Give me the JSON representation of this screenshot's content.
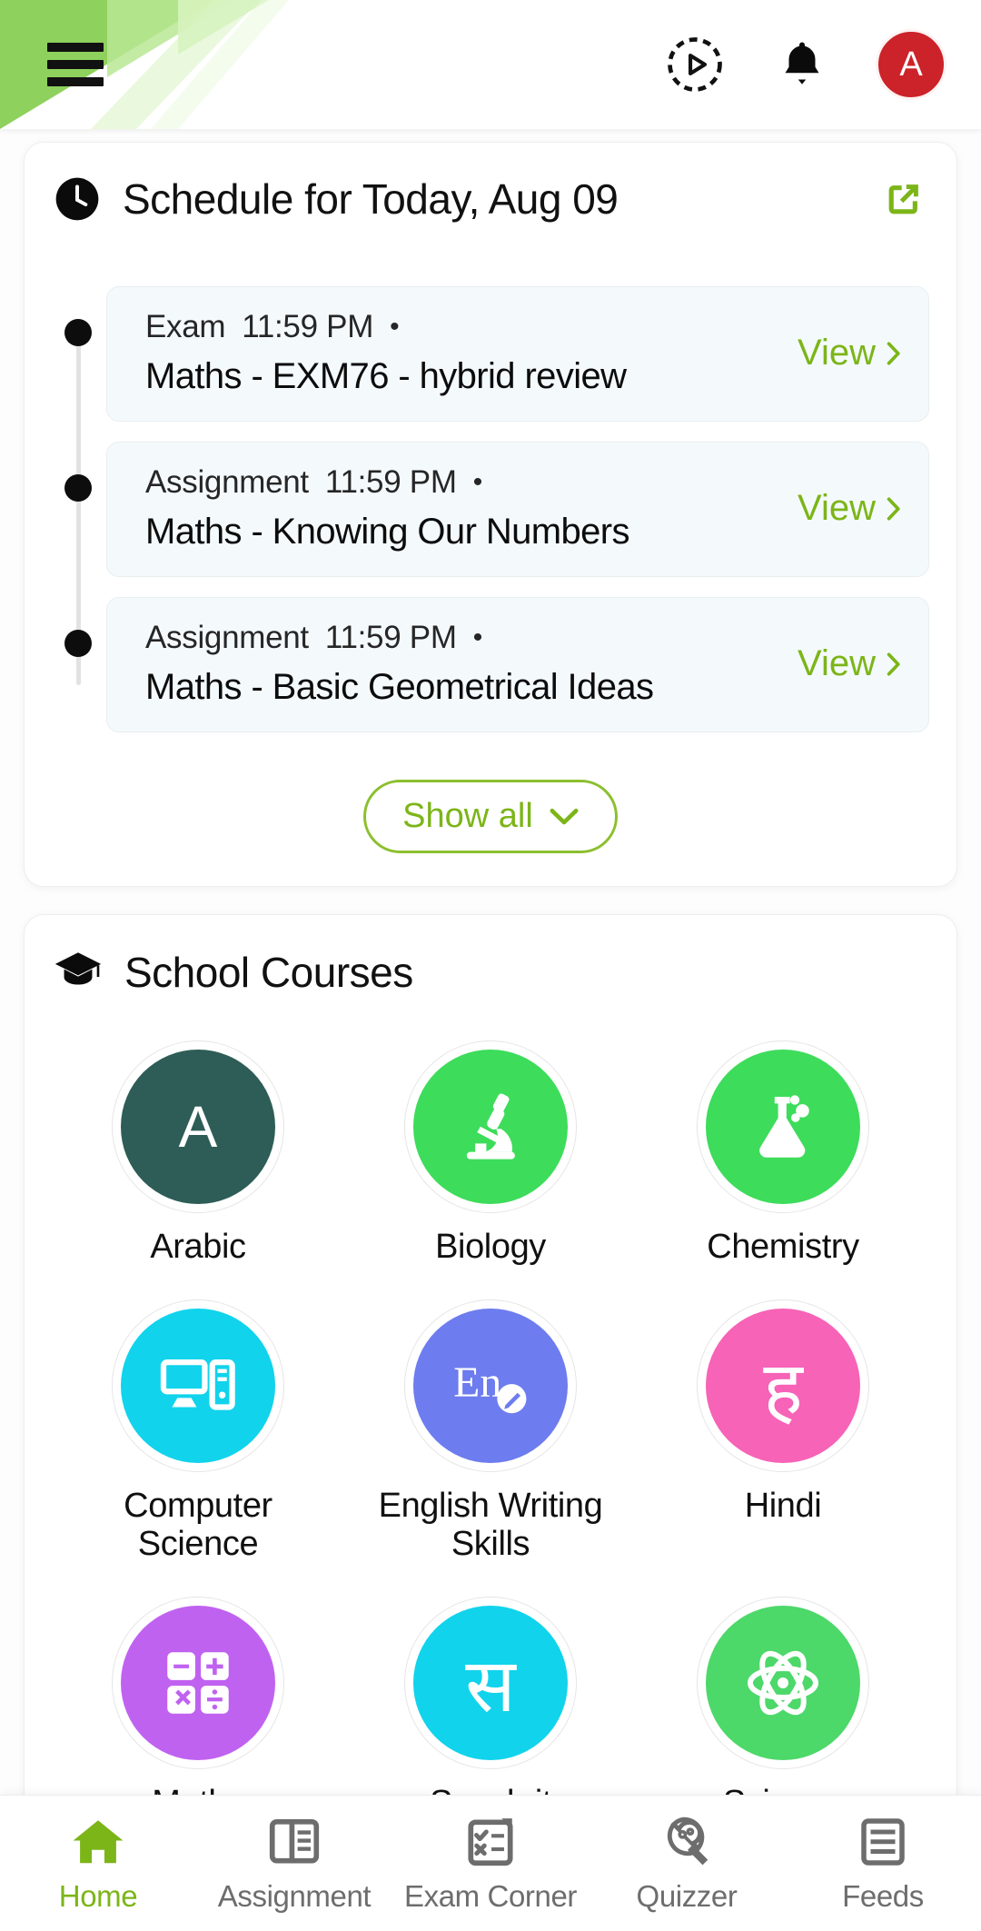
{
  "header": {
    "menu_icon": "hamburger-menu-icon",
    "play_icon": "play-circle-icon",
    "bell_icon": "notification-bell-icon",
    "avatar_initial": "A",
    "avatar_color": "#cc2229",
    "accent_color": "#7cb518"
  },
  "schedule": {
    "icon": "clock-icon",
    "title": "Schedule for Today, Aug 09",
    "expand_icon": "external-link-icon",
    "items": [
      {
        "type": "Exam",
        "time": "11:59 PM",
        "bullet": "•",
        "title": "Maths - EXM76  -  hybrid review",
        "action": "View"
      },
      {
        "type": "Assignment",
        "time": "11:59 PM",
        "bullet": "•",
        "title": "Maths - Knowing Our Numbers",
        "action": "View"
      },
      {
        "type": "Assignment",
        "time": "11:59 PM",
        "bullet": "•",
        "title": "Maths - Basic Geometrical Ideas",
        "action": "View"
      }
    ],
    "show_all_label": "Show all"
  },
  "courses": {
    "icon": "graduation-cap-icon",
    "title": "School Courses",
    "items": [
      {
        "label": "Arabic",
        "glyph": "A",
        "glyph_type": "letter",
        "color": "#2d5d56",
        "icon": "letter-a-icon"
      },
      {
        "label": "Biology",
        "glyph": "",
        "glyph_type": "svg",
        "color": "#3ddc5b",
        "icon": "microscope-icon"
      },
      {
        "label": "Chemistry",
        "glyph": "",
        "glyph_type": "svg",
        "color": "#3ddc5b",
        "icon": "flask-icon"
      },
      {
        "label": "Computer Science",
        "glyph": "",
        "glyph_type": "svg",
        "color": "#11d3ec",
        "icon": "desktop-computer-icon"
      },
      {
        "label": "English Writing Skills",
        "glyph": "En",
        "glyph_type": "svg",
        "color": "#6d7cee",
        "icon": "en-pencil-icon"
      },
      {
        "label": "Hindi",
        "glyph": "ह",
        "glyph_type": "letter-light",
        "color": "#f663b7",
        "icon": "devanagari-ha-icon"
      },
      {
        "label": "Maths",
        "glyph": "",
        "glyph_type": "svg",
        "color": "#c062f0",
        "icon": "calculator-icon"
      },
      {
        "label": "Sanskrit",
        "glyph": "स",
        "glyph_type": "letter-light",
        "color": "#11d3ec",
        "icon": "devanagari-sa-icon"
      },
      {
        "label": "Science",
        "glyph": "",
        "glyph_type": "svg",
        "color": "#4dd86a",
        "icon": "atom-icon"
      }
    ]
  },
  "bottom_nav": {
    "items": [
      {
        "label": "Home",
        "icon": "home-icon",
        "active": true
      },
      {
        "label": "Assignment",
        "icon": "book-icon",
        "active": false
      },
      {
        "label": "Exam Corner",
        "icon": "clipboard-icon",
        "active": false
      },
      {
        "label": "Quizzer",
        "icon": "lightbulb-icon",
        "active": false
      },
      {
        "label": "Feeds",
        "icon": "feed-icon",
        "active": false
      }
    ]
  }
}
